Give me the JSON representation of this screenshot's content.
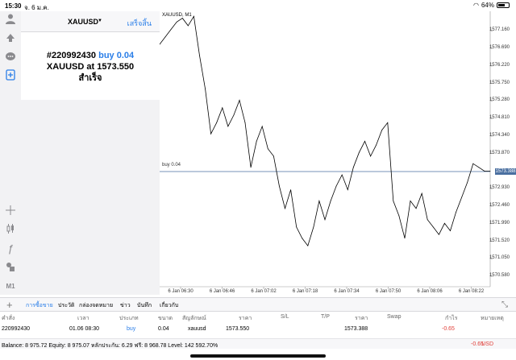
{
  "status": {
    "time": "15:30",
    "date": "จ. 6 ม.ค.",
    "battery": "64%",
    "battery_level": 0.64
  },
  "order_panel": {
    "symbol": "XAUUSD",
    "done_label": "เสร็จสิ้น",
    "order_id": "#220992430",
    "side": "buy 0.04",
    "at_text": "XAUUSD at",
    "price": "1573.550",
    "result": "สำเร็จ"
  },
  "chart": {
    "title": "XAUUSD, M1",
    "bid_label": "buy 0.04",
    "bid_price": "1573.388",
    "price_ticks": [
      "1577.160",
      "1576.690",
      "1576.220",
      "1575.750",
      "1575.280",
      "1574.810",
      "1574.340",
      "1573.870",
      "1572.930",
      "1572.460",
      "1571.990",
      "1571.520",
      "1571.050",
      "1570.580"
    ],
    "time_ticks": [
      "6 Jan 06:30",
      "6 Jan 06:46",
      "6 Jan 07:02",
      "6 Jan 07:18",
      "6 Jan 07:34",
      "6 Jan 07:50",
      "6 Jan 08:06",
      "6 Jan 08:22"
    ]
  },
  "chart_data": {
    "type": "line",
    "title": "XAUUSD, M1",
    "xlabel": "",
    "ylabel": "",
    "ylim": [
      1570.3,
      1577.6
    ],
    "x": [
      "06:30",
      "06:32",
      "06:34",
      "06:36",
      "06:38",
      "06:40",
      "06:42",
      "06:44",
      "06:46",
      "06:48",
      "06:50",
      "06:52",
      "06:54",
      "06:56",
      "06:58",
      "07:00",
      "07:02",
      "07:04",
      "07:06",
      "07:08",
      "07:10",
      "07:12",
      "07:14",
      "07:16",
      "07:18",
      "07:20",
      "07:22",
      "07:24",
      "07:26",
      "07:28",
      "07:30",
      "07:32",
      "07:34",
      "07:36",
      "07:38",
      "07:40",
      "07:42",
      "07:44",
      "07:46",
      "07:48",
      "07:50",
      "07:52",
      "07:54",
      "07:56",
      "07:58",
      "08:00",
      "08:02",
      "08:04",
      "08:06",
      "08:08",
      "08:10",
      "08:12",
      "08:14",
      "08:16",
      "08:18",
      "08:20",
      "08:22",
      "08:24",
      "08:26"
    ],
    "values": [
      1576.8,
      1577.0,
      1577.2,
      1577.4,
      1577.5,
      1577.3,
      1577.55,
      1576.5,
      1575.6,
      1574.4,
      1574.7,
      1575.1,
      1574.6,
      1574.9,
      1575.3,
      1574.7,
      1573.5,
      1574.2,
      1574.6,
      1574.0,
      1573.8,
      1573.0,
      1572.4,
      1572.9,
      1571.9,
      1571.6,
      1571.4,
      1571.9,
      1572.6,
      1572.1,
      1572.6,
      1573.0,
      1573.3,
      1572.9,
      1573.5,
      1573.9,
      1574.2,
      1573.8,
      1574.1,
      1574.5,
      1574.7,
      1572.6,
      1572.2,
      1571.6,
      1572.6,
      1572.4,
      1572.8,
      1572.1,
      1571.9,
      1571.7,
      1572.0,
      1571.8,
      1572.3,
      1572.7,
      1573.1,
      1573.6,
      1573.5,
      1573.4,
      1573.4
    ],
    "series": [
      {
        "values": []
      }
    ],
    "bid_line": 1573.388
  },
  "toolbox": {
    "tabs": [
      "การซื้อขาย",
      "ประวัติ",
      "กล่องจดหมาย",
      "ข่าว",
      "บันทึก",
      "เกี่ยวกับ"
    ],
    "columns": [
      "คำสั่ง",
      "เวลา",
      "ประเภท",
      "ขนาด",
      "สัญลักษณ์",
      "ราคา",
      "S/L",
      "T/P",
      "ราคา",
      "Swap",
      "กำไร",
      "หมายเหตุ"
    ],
    "row": {
      "order": "220992430",
      "time": "01.06 08:30",
      "type": "buy",
      "size": "0.04",
      "symbol": "xauusd",
      "open_price": "1573.550",
      "price": "1573.388",
      "profit": "-0.65"
    },
    "balance_text": "Balance: 8 975.72 Equity: 8 975.07 หลักประกัน: 6.29 ฟรี: 8 968.78 Level: 142 592.70%",
    "balance_profit": "-0.65",
    "currency": "USD"
  },
  "colors": {
    "accent": "#2a7ee8",
    "loss": "#e0403a",
    "bid_box": "#4a6fa0"
  },
  "icons": [
    "user-icon",
    "trade-icon",
    "chat-icon",
    "new-order-icon",
    "crosshair-icon",
    "candle-icon",
    "function-icon",
    "objects-icon",
    "timeframe-icon",
    "add-icon",
    "resize-icon"
  ],
  "left_tools": {
    "timeframe": "M1"
  }
}
